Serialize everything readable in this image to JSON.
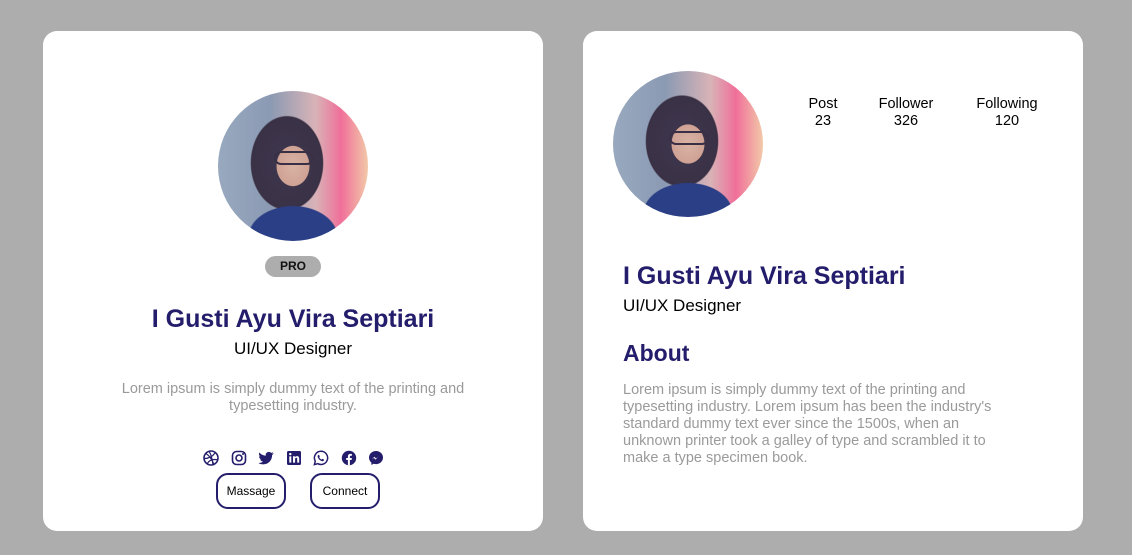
{
  "left_card": {
    "badge": "PRO",
    "name": "I Gusti Ayu Vira Septiari",
    "role": "UI/UX Designer",
    "description": "Lorem ipsum is simply dummy text of the printing and typesetting industry.",
    "social_icons": [
      "dribbble-icon",
      "instagram-icon",
      "twitter-icon",
      "linkedin-icon",
      "whatsapp-icon",
      "facebook-icon",
      "messenger-icon"
    ],
    "buttons": {
      "message": "Massage",
      "connect": "Connect"
    }
  },
  "right_card": {
    "stats": [
      {
        "label": "Post",
        "value": "23"
      },
      {
        "label": "Follower",
        "value": "326"
      },
      {
        "label": "Following",
        "value": "120"
      }
    ],
    "name": "I Gusti Ayu Vira Septiari",
    "role": "UI/UX Designer",
    "about_heading": "About",
    "about_text": "Lorem ipsum is simply dummy text of the printing and typesetting industry. Lorem ipsum has been the industry's standard dummy text ever since the 1500s, when an unknown printer took a galley of type and scrambled it to make a type specimen book."
  },
  "colors": {
    "background": "#adadad",
    "card": "#ffffff",
    "accent": "#231d6b",
    "muted_text": "#9a9a9a"
  }
}
